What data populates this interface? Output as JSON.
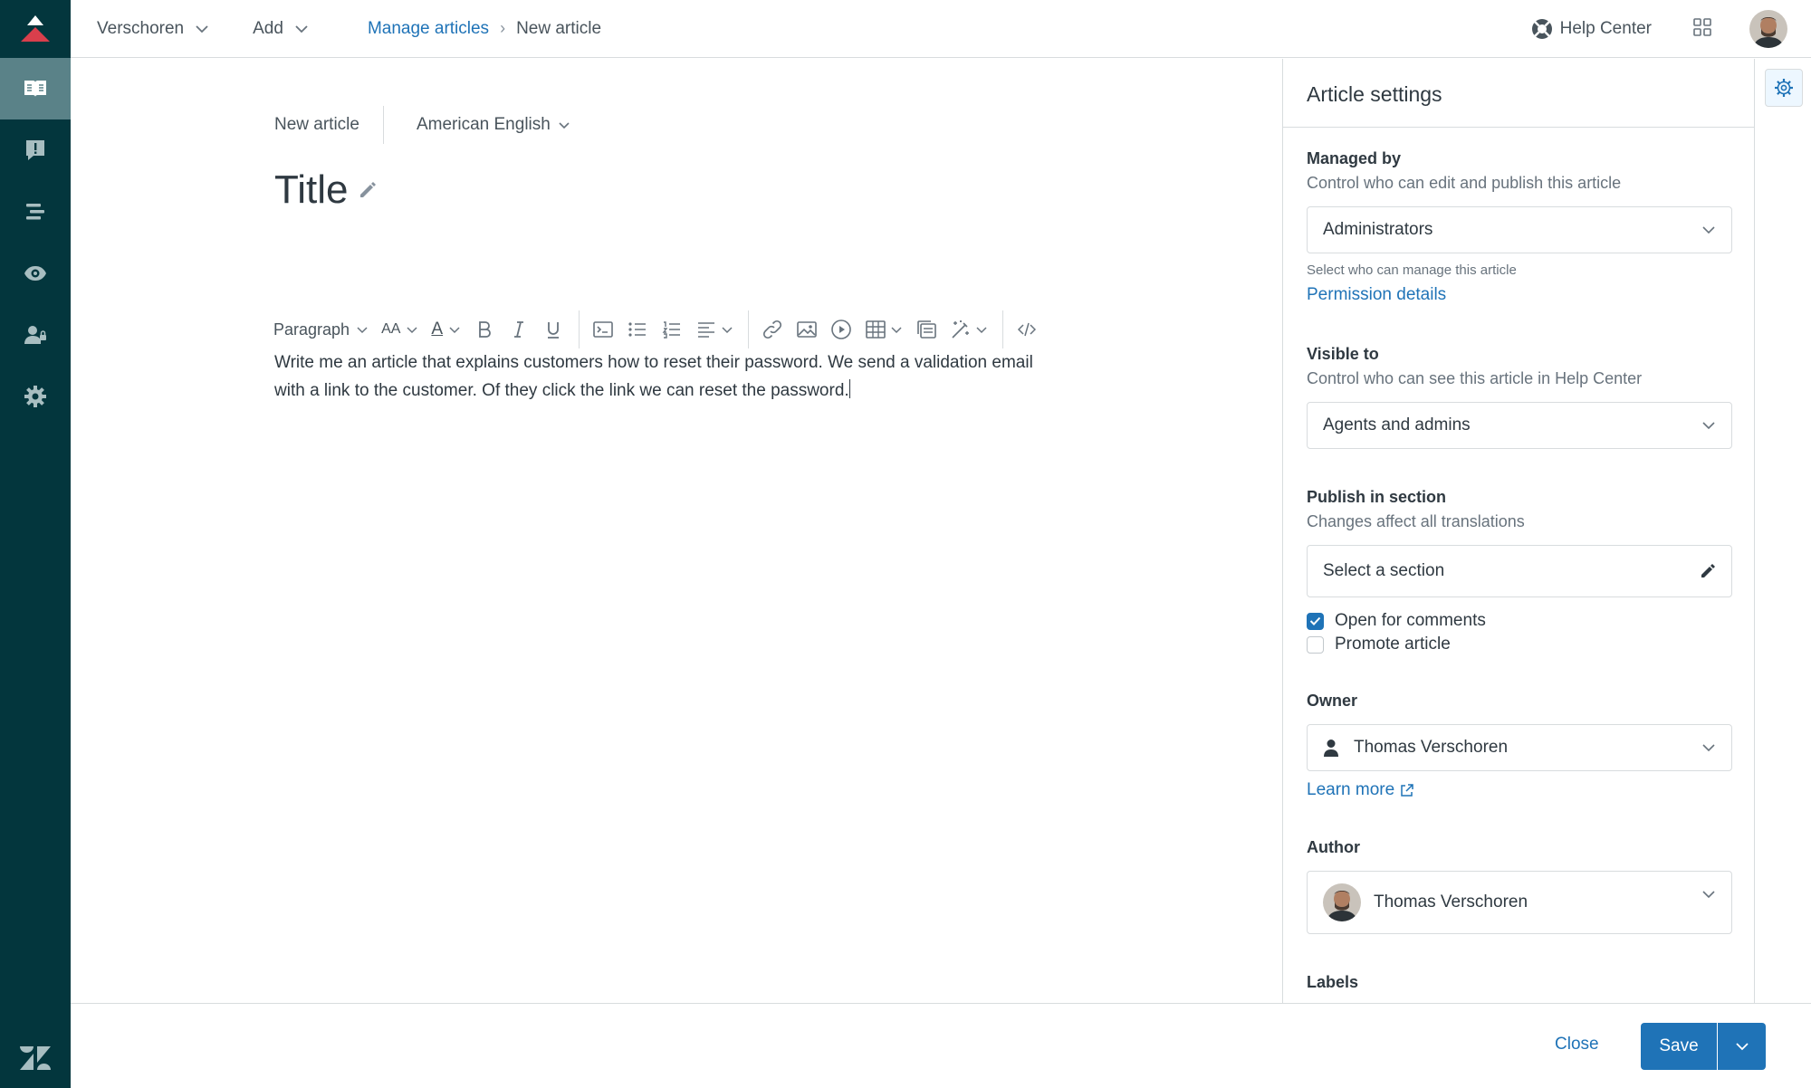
{
  "topbar": {
    "workspace": "Verschoren",
    "add": "Add",
    "breadcrumb_parent": "Manage articles",
    "breadcrumb_current": "New article",
    "help_center": "Help Center"
  },
  "editor": {
    "article_label": "New article",
    "language": "American English",
    "title": "Title",
    "toolbar": {
      "paragraph": "Paragraph",
      "font_size": "AA",
      "text_color": "A"
    },
    "body_line1": "Write me an article that explains customers how to reset their password. We send a validation email",
    "body_line2": "with a link to the customer. Of they click the link we can reset the password."
  },
  "settings": {
    "header": "Article settings",
    "managed_by": {
      "label": "Managed by",
      "hint": "Control who can edit and publish this article",
      "value": "Administrators",
      "small_hint": "Select who can manage this article",
      "link": "Permission details"
    },
    "visible_to": {
      "label": "Visible to",
      "hint": "Control who can see this article in Help Center",
      "value": "Agents and admins"
    },
    "publish": {
      "label": "Publish in section",
      "hint": "Changes affect all translations",
      "placeholder": "Select a section"
    },
    "checkboxes": {
      "open_comments": "Open for comments",
      "open_comments_checked": true,
      "promote": "Promote article",
      "promote_checked": false
    },
    "owner": {
      "label": "Owner",
      "value": "Thomas Verschoren",
      "link": "Learn more"
    },
    "author": {
      "label": "Author",
      "value": "Thomas Verschoren"
    },
    "labels": {
      "label": "Labels"
    }
  },
  "footer": {
    "close": "Close",
    "save": "Save"
  },
  "colors": {
    "nav_bg": "#03363d",
    "nav_active": "#5a8288",
    "accent": "#1f73b7",
    "logo_red": "#d93f4c"
  }
}
